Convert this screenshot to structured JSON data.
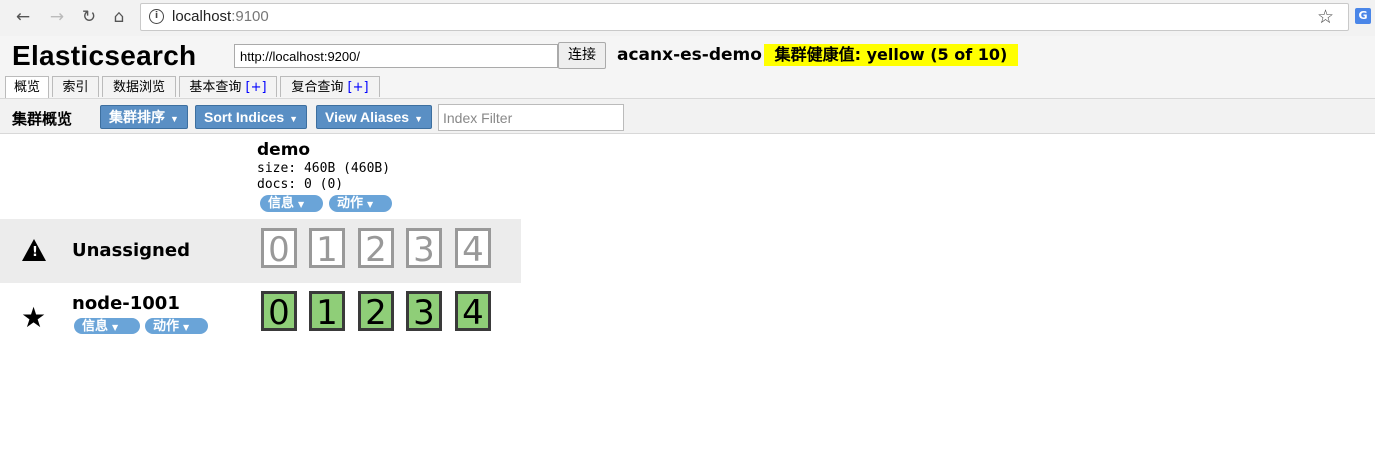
{
  "browser": {
    "url_host": "localhost",
    "url_port": ":9100",
    "back_icon": "arrow-left-icon",
    "forward_icon": "arrow-right-icon",
    "reload_icon": "reload-icon",
    "home_icon": "home-icon",
    "bookmark_icon": "star-outline-icon",
    "extension_label": "G"
  },
  "header": {
    "brand": "Elasticsearch",
    "connect_url": "http://localhost:9200/",
    "connect_button": "连接",
    "cluster_name": "acanx-es-demo",
    "health": "集群健康值: yellow (5 of 10)",
    "health_color": "#ffff00"
  },
  "tabs": [
    {
      "label": "概览",
      "active": true
    },
    {
      "label": "索引"
    },
    {
      "label": "数据浏览"
    },
    {
      "label": "基本查询",
      "plus": "[+]"
    },
    {
      "label": "复合查询",
      "plus": "[+]"
    }
  ],
  "toolbar": {
    "title": "集群概览",
    "sort_cluster": "集群排序",
    "sort_indices": "Sort Indices",
    "view_aliases": "View Aliases",
    "index_filter_placeholder": "Index Filter",
    "button_color": "#5a8fc4"
  },
  "index": {
    "name": "demo",
    "size": "size: 460B (460B)",
    "docs": "docs: 0 (0)",
    "info_button": "信息",
    "action_button": "动作"
  },
  "rows": [
    {
      "name": "Unassigned",
      "icon": "warning-icon",
      "shards": [
        "0",
        "1",
        "2",
        "3",
        "4"
      ],
      "state": "unassigned"
    },
    {
      "name": "node-1001",
      "icon": "star-icon",
      "info_button": "信息",
      "action_button": "动作",
      "shards": [
        "0",
        "1",
        "2",
        "3",
        "4"
      ],
      "state": "started",
      "shard_color": "#8fce78"
    }
  ]
}
